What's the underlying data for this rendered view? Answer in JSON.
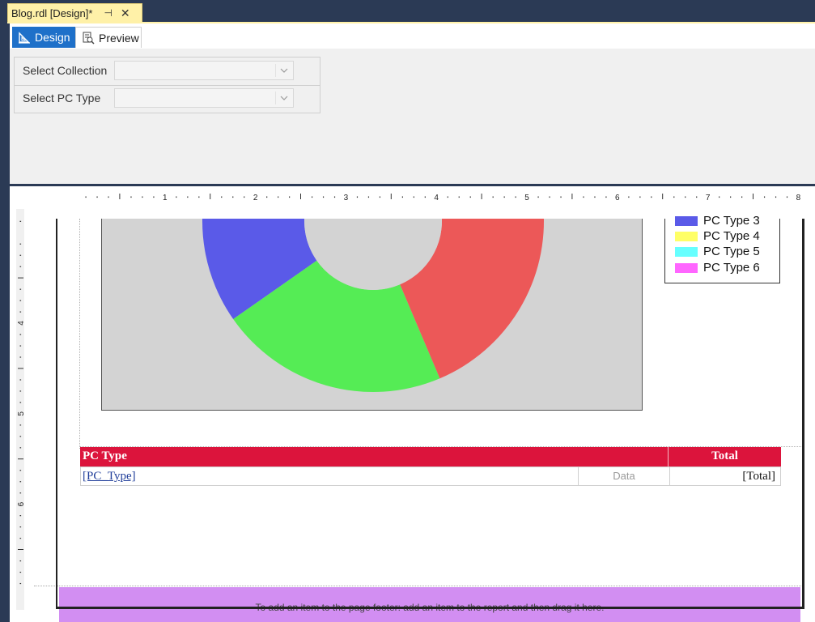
{
  "document_tab": {
    "title": "Blog.rdl [Design]*",
    "pin_icon": "pin-icon",
    "close_icon": "close-icon",
    "color": "#fff1a8"
  },
  "view_tabs": [
    {
      "label": "Design",
      "icon": "design-icon",
      "active": true
    },
    {
      "label": "Preview",
      "icon": "preview-icon",
      "active": false
    }
  ],
  "parameters": [
    {
      "label": "Select Collection",
      "value": ""
    },
    {
      "label": "Select PC Type",
      "value": ""
    }
  ],
  "ruler": {
    "horizontal_labels": [
      "1",
      "2",
      "3",
      "4",
      "5",
      "6",
      "7",
      "8"
    ],
    "vertical_labels": [
      "4",
      "5",
      "6"
    ]
  },
  "chart": {
    "type": "donut",
    "background": "#d3d3d3",
    "legend": [
      {
        "label": "PC Type 3",
        "color": "#5a5ae8"
      },
      {
        "label": "PC Type 4",
        "color": "#ffff66"
      },
      {
        "label": "PC Type 5",
        "color": "#66ffff"
      },
      {
        "label": "PC Type 6",
        "color": "#ff66ff"
      }
    ],
    "visible_segments": [
      {
        "color": "#5a5ae8"
      },
      {
        "color": "#55ec55"
      },
      {
        "color": "#ec5858"
      },
      {
        "color": "#ff66ff"
      }
    ]
  },
  "table": {
    "header": {
      "col1": "PC Type",
      "col3": "Total",
      "color": "#dc143c"
    },
    "row": {
      "col1": "[PC_Type]",
      "col2": "Data",
      "col3": "[Total]"
    }
  },
  "footer": {
    "message": "To add an item to the page footer: add an item to the report and then drag it here.",
    "color": "#d28ef2"
  }
}
